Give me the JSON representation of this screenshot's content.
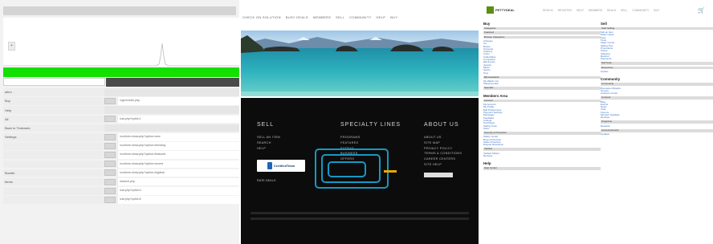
{
  "left": {
    "small_button": "+",
    "rows": [
      {
        "name": "aihm",
        "val": "",
        "blank": true,
        "btn": false
      },
      {
        "name": "Buy",
        "val": "/vgen/order.php",
        "blank": false,
        "btn": true
      },
      {
        "name": "Help",
        "val": "",
        "blank": true,
        "btn": false
      },
      {
        "name": "All",
        "val": "/cat.php?cptId=1",
        "blank": false,
        "btn": true
      },
      {
        "name": "Back to Tindrawio",
        "val": "",
        "blank": true,
        "btn": false
      },
      {
        "name": "Settings",
        "val": "/conform.show.php?option=new",
        "blank": false,
        "btn": true
      },
      {
        "name": "",
        "val": "/conform.show.php?option=trending",
        "blank": false,
        "btn": true
      },
      {
        "name": "",
        "val": "/conform.show.php?option=featured",
        "blank": false,
        "btn": true
      },
      {
        "name": "",
        "val": "/conform.show.php?option=recent",
        "blank": false,
        "btn": true
      },
      {
        "name": "Bundle",
        "val": "/conform.show.php?option=bigdeal",
        "blank": false,
        "btn": true
      },
      {
        "name": "Items",
        "val": "/search.php",
        "blank": false,
        "btn": true
      },
      {
        "name": "",
        "val": "/cat.php?cptId=4",
        "blank": false,
        "btn": true
      },
      {
        "name": "",
        "val": "/cat.php?cptId=5",
        "blank": false,
        "btn": true
      }
    ]
  },
  "mid": {
    "nav": [
      "CHECK ON SOLUTION",
      "BUSY DEALS",
      "MEMBERS",
      "SELL",
      "COMMUNITY",
      "HELP",
      "BUY"
    ],
    "footer": {
      "sell": {
        "title": "SELL",
        "links": [
          "SELL AN ITEM",
          "SEARCH",
          "HELP"
        ],
        "badge": "CertifiedTeam",
        "bottom": "RATE DEALS"
      },
      "specialty": {
        "title": "SPECIALTY LINES",
        "links": [
          "PROGRAMS",
          "FEATURES",
          "EXTRAS",
          "BUSINESS",
          "OFFERS"
        ]
      },
      "about": {
        "title": "ABOUT US",
        "links": [
          "ABOUT US",
          "SITE MAP",
          "PRIVACY POLICY",
          "TERMS & CONDITIONS",
          "CAREER CENTERS",
          "SITE HELP"
        ]
      }
    }
  },
  "right": {
    "logo_text": "PETTYDEAL",
    "topnav": [
      "SIGN IN",
      "REGISTER",
      "HELP",
      "MEMBERS",
      "DEALS",
      "SELL",
      "COMMUNITY",
      "BUY"
    ],
    "cart_icon": "shopping-cart-icon",
    "col1": {
      "sections": [
        {
          "title": "Buy",
          "blocks": [
            {
              "hdr": "Categories",
              "links": []
            },
            {
              "hdr": "Featured",
              "links": []
            },
            {
              "hdr": "Browse Categories",
              "links": [
                "Antiques",
                "Art",
                "Books",
                "Cameras",
                "Clothing",
                "Coins",
                "Collectibles",
                "Computers",
                "Electronics",
                "Jewelry",
                "Music",
                "Sports",
                "Toys"
              ]
            },
            {
              "hdr": "Bid Assistants",
              "links": [
                "My Watch List",
                "Shipping Help"
              ]
            },
            {
              "hdr": "Specials",
              "links": []
            }
          ]
        },
        {
          "title": "Members Area",
          "blocks": [
            {
              "hdr": "Account",
              "links": [
                "My Account",
                "My Profile",
                "Edit Preferences",
                "Payment Settings",
                "Messages",
                "Feedback",
                "Listings",
                "Purchases",
                "Selling Tools",
                "Store"
              ]
            },
            {
              "hdr": "Security & Protection",
              "links": [
                "Safety Center",
                "Buyer Protection",
                "Seller Protection",
                "Dispute Resolution"
              ]
            },
            {
              "hdr": "Verified",
              "links": [
                "Verified Sellers",
                "Reviews"
              ]
            }
          ]
        },
        {
          "title": "Help",
          "blocks": [
            {
              "hdr": "Help Center",
              "links": []
            }
          ]
        }
      ]
    },
    "col2": {
      "sections": [
        {
          "title": "Sell",
          "blocks": [
            {
              "hdr": "Start Selling",
              "links": [
                "Sell an Item",
                "Seller Guide",
                "Fees",
                "Tools",
                "Seller Center",
                "Selling Tips",
                "Promotions",
                "Stores",
                "Shipping",
                "Returns",
                "Payments"
              ]
            },
            {
              "hdr": "Sell Tools",
              "links": []
            },
            {
              "hdr": "Resources",
              "links": [
                "Guides"
              ]
            }
          ]
        },
        {
          "title": "Community",
          "blocks": [
            {
              "hdr": "Community",
              "links": [
                "Discussion Boards",
                "Groups",
                "Answers Center"
              ]
            },
            {
              "hdr": "Connect",
              "links": [
                "Blog",
                "Events",
                "News",
                "Chat",
                "Forums",
                "Member Spotlight",
                "Reviews"
              ]
            },
            {
              "hdr": "Programs",
              "links": [
                "Rewards"
              ]
            },
            {
              "hdr": "Announcements",
              "links": [
                "Updates"
              ]
            }
          ]
        }
      ]
    }
  }
}
